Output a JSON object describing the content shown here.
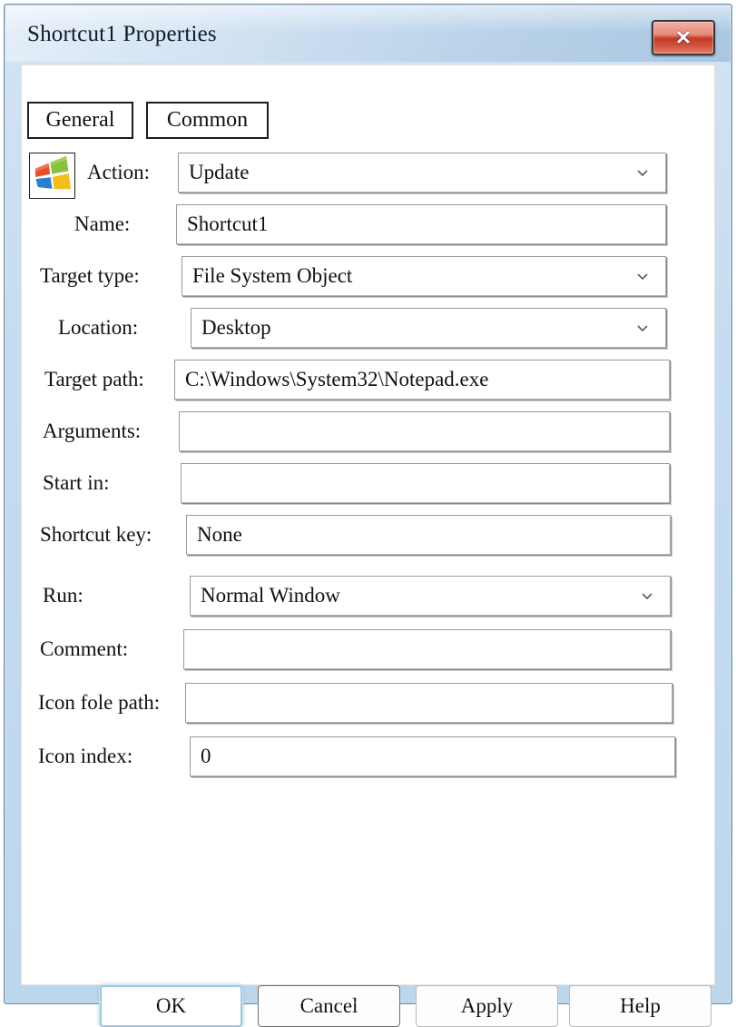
{
  "window": {
    "title": "Shortcut1 Properties",
    "close_label": "✕",
    "accent_titlebar": "#bcd4ea",
    "accent_close": "#c33a27",
    "accent_focus": "#9fc9dd"
  },
  "tabs": [
    {
      "label": "General",
      "selected": true
    },
    {
      "label": "Common",
      "selected": false
    }
  ],
  "icon": {
    "name": "windows-flag-icon"
  },
  "fields": [
    {
      "label": "Action:",
      "value": "Update",
      "type": "combo"
    },
    {
      "label": "Name:",
      "value": "Shortcut1",
      "type": "text"
    },
    {
      "label": "Target type:",
      "value": "File System Object",
      "type": "combo"
    },
    {
      "label": "Location:",
      "value": "Desktop",
      "type": "combo"
    },
    {
      "label": "Target path:",
      "value": "C:\\Windows\\System32\\Notepad.exe",
      "type": "text"
    },
    {
      "label": "Arguments:",
      "value": "",
      "type": "text"
    },
    {
      "label": "Start in:",
      "value": "",
      "type": "text"
    },
    {
      "label": "Shortcut key:",
      "value": "None",
      "type": "text"
    },
    {
      "label": "Run:",
      "value": "Normal Window",
      "type": "combo"
    },
    {
      "label": "Comment:",
      "value": "",
      "type": "text"
    },
    {
      "label": "Icon fole path:",
      "value": "",
      "type": "text"
    },
    {
      "label": "Icon index:",
      "value": "0",
      "type": "text"
    }
  ],
  "buttons": {
    "ok": "OK",
    "cancel": "Cancel",
    "apply": "Apply",
    "help": "Help"
  }
}
